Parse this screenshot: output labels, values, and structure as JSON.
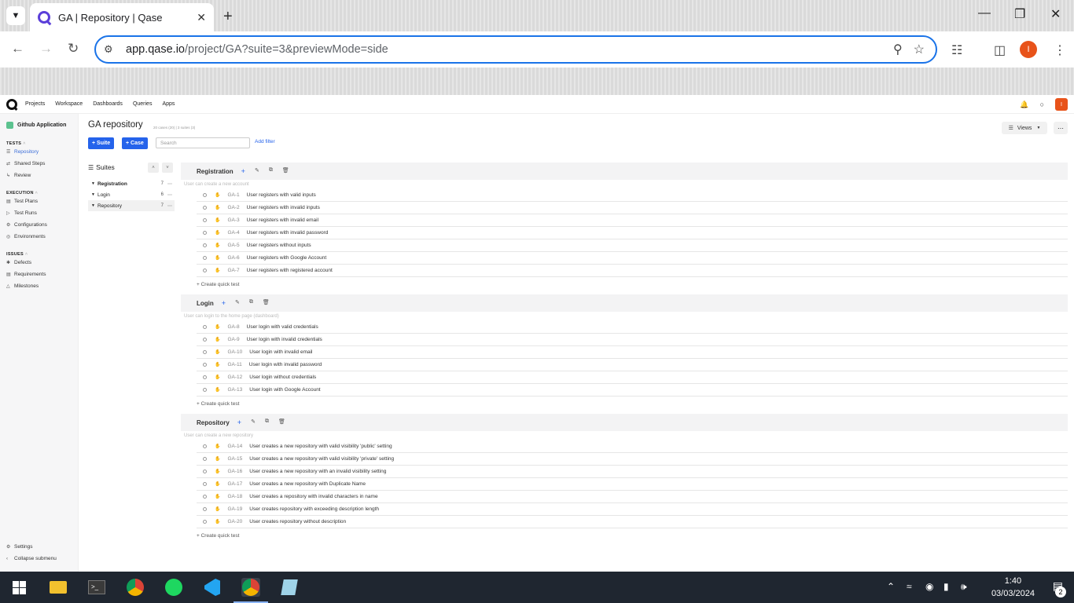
{
  "browser": {
    "tab_title": "GA | Repository | Qase",
    "url_host": "app.qase.io",
    "url_path": "/project/GA?suite=3&previewMode=side",
    "profile_initial": "I"
  },
  "topnav": {
    "items": [
      "Projects",
      "Workspace",
      "Dashboards",
      "Queries",
      "Apps"
    ],
    "avatar": "I"
  },
  "sidebar": {
    "project": "Github Application",
    "sections": [
      {
        "title": "TESTS",
        "items": [
          {
            "label": "Repository",
            "icon": "list-icon"
          },
          {
            "label": "Shared Steps",
            "icon": "steps-icon"
          },
          {
            "label": "Review",
            "icon": "review-icon"
          }
        ]
      },
      {
        "title": "EXECUTION",
        "items": [
          {
            "label": "Test Plans",
            "icon": "plan-icon"
          },
          {
            "label": "Test Runs",
            "icon": "play-icon"
          },
          {
            "label": "Configurations",
            "icon": "wrench-icon"
          },
          {
            "label": "Environments",
            "icon": "globe-icon"
          }
        ]
      },
      {
        "title": "ISSUES",
        "items": [
          {
            "label": "Defects",
            "icon": "bug-icon"
          },
          {
            "label": "Requirements",
            "icon": "doc-icon"
          },
          {
            "label": "Milestones",
            "icon": "milestone-icon"
          }
        ]
      }
    ],
    "settings": "Settings",
    "collapse": "Collapse submenu"
  },
  "main": {
    "title": "GA repository",
    "meta": "20 cases (20) | 3 suites (3)",
    "suite_btn": "+ Suite",
    "case_btn": "+ Case",
    "search_placeholder": "Search",
    "add_filter": "Add filter",
    "views": "Views",
    "suites_title": "Suites",
    "tree": [
      {
        "name": "Registration",
        "count": "7"
      },
      {
        "name": "Login",
        "count": "6"
      },
      {
        "name": "Repository",
        "count": "7"
      }
    ],
    "create_quick": "+ Create quick test",
    "suites": [
      {
        "name": "Registration",
        "desc": "User can create a new account",
        "cases": [
          {
            "id": "GA-1",
            "title": "User registers with valid inputs"
          },
          {
            "id": "GA-2",
            "title": "User registers with invalid inputs"
          },
          {
            "id": "GA-3",
            "title": "User registers with invalid email"
          },
          {
            "id": "GA-4",
            "title": "User registers with invalid password"
          },
          {
            "id": "GA-5",
            "title": "User registers without inputs"
          },
          {
            "id": "GA-6",
            "title": "User registers with Google Account"
          },
          {
            "id": "GA-7",
            "title": "User registers with registered account"
          }
        ]
      },
      {
        "name": "Login",
        "desc": "User can login to the home page (dashboard)",
        "cases": [
          {
            "id": "GA-8",
            "title": "User login with valid credentials"
          },
          {
            "id": "GA-9",
            "title": "User login with invalid credentials"
          },
          {
            "id": "GA-10",
            "title": "User login with invalid email"
          },
          {
            "id": "GA-11",
            "title": "User login with invalid password"
          },
          {
            "id": "GA-12",
            "title": "User login without credentials"
          },
          {
            "id": "GA-13",
            "title": "User login with Google Account"
          }
        ]
      },
      {
        "name": "Repository",
        "desc": "User can create a new repository",
        "cases": [
          {
            "id": "GA-14",
            "title": "User creates a new repository with valid visibility 'public' setting"
          },
          {
            "id": "GA-15",
            "title": "User creates a new repository with valid visibility 'private' setting"
          },
          {
            "id": "GA-16",
            "title": "User creates a new repository with an invalid visibility setting"
          },
          {
            "id": "GA-17",
            "title": "User creates a new repository with Duplicate Name"
          },
          {
            "id": "GA-18",
            "title": "User creates a repository with invalid characters in name"
          },
          {
            "id": "GA-19",
            "title": "User creates repository with exceeding description length"
          },
          {
            "id": "GA-20",
            "title": "User creates repository without description"
          }
        ]
      }
    ]
  },
  "taskbar": {
    "time": "1:40",
    "date": "03/03/2024",
    "notifications": "2",
    "apps": [
      "file-explorer-icon",
      "terminal-icon",
      "chrome-icon",
      "spotify-icon",
      "vscode-icon",
      "chrome-profile-icon",
      "notepad-icon"
    ]
  }
}
